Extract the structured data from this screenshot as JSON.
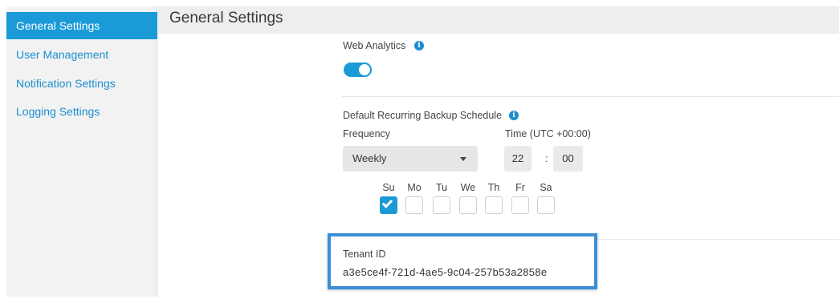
{
  "sidebar": {
    "items": [
      {
        "label": "General Settings",
        "active": true
      },
      {
        "label": "User Management",
        "active": false
      },
      {
        "label": "Notification Settings",
        "active": false
      },
      {
        "label": "Logging Settings",
        "active": false
      }
    ]
  },
  "header": {
    "title": "General Settings"
  },
  "analytics": {
    "label": "Web Analytics",
    "info_icon": "info-icon",
    "enabled": true
  },
  "backup": {
    "title": "Default Recurring Backup Schedule",
    "frequency_label": "Frequency",
    "frequency_value": "Weekly",
    "time_label": "Time (UTC +00:00)",
    "hour": "22",
    "separator": ":",
    "minute": "00",
    "days": [
      {
        "label": "Su",
        "checked": true
      },
      {
        "label": "Mo",
        "checked": false
      },
      {
        "label": "Tu",
        "checked": false
      },
      {
        "label": "We",
        "checked": false
      },
      {
        "label": "Th",
        "checked": false
      },
      {
        "label": "Fr",
        "checked": false
      },
      {
        "label": "Sa",
        "checked": false
      }
    ]
  },
  "tenant": {
    "label": "Tenant ID",
    "value": "a3e5ce4f-721d-4ae5-9c04-257b53a2858e"
  },
  "colors": {
    "accent": "#1a9bd7",
    "highlight_border": "#3a8fd6",
    "link": "#1a8fcf"
  }
}
